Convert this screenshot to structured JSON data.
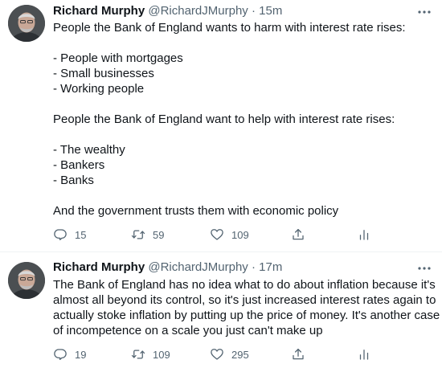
{
  "tweets": [
    {
      "display_name": "Richard Murphy",
      "handle": "@RichardJMurphy",
      "separator": "·",
      "time": "15m",
      "lines": [
        "People the Bank of England wants to harm with interest rate rises:",
        "",
        "- People with mortgages",
        "- Small businesses",
        "- Working people",
        "",
        "People the Bank of England want to help with interest rate rises:",
        "",
        "- The wealthy",
        "- Bankers",
        "- Banks",
        "",
        "And the government trusts them with economic policy"
      ],
      "replies": "15",
      "retweets": "59",
      "likes": "109"
    },
    {
      "display_name": "Richard Murphy",
      "handle": "@RichardJMurphy",
      "separator": "·",
      "time": "17m",
      "lines": [
        "The Bank of England has no idea what to do about inflation because it's",
        "almost all beyond its control, so it's just increased interest rates again to",
        "actually stoke inflation by putting up the price of money. It's another case",
        "of incompetence on a scale you just can't make up"
      ],
      "replies": "19",
      "retweets": "109",
      "likes": "295"
    }
  ],
  "icons": {
    "more": "more-horizontal-icon",
    "reply": "reply-icon",
    "retweet": "retweet-icon",
    "like": "heart-icon",
    "share": "share-icon",
    "analytics": "analytics-icon"
  },
  "colors": {
    "text": "#0f1419",
    "secondary": "#536471",
    "divider": "#eff3f4"
  }
}
